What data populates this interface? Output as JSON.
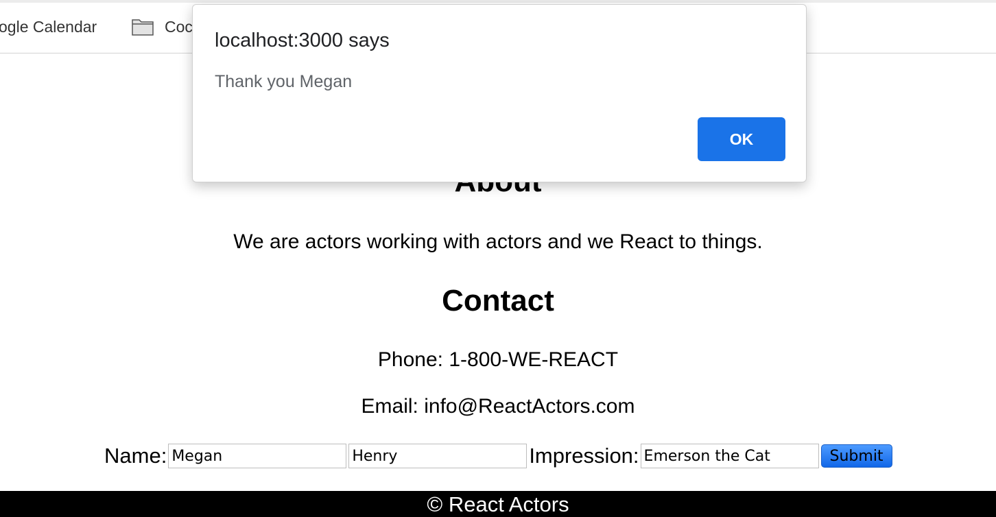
{
  "bookmarks": [
    {
      "label": "ogle Calendar"
    },
    {
      "label": "Coc",
      "icon": "folder-icon"
    }
  ],
  "page": {
    "about_heading": "About",
    "about_text": "We are actors working with actors and we React to things.",
    "contact_heading": "Contact",
    "phone": "Phone: 1-800-WE-REACT",
    "email": "Email: info@ReactActors.com"
  },
  "form": {
    "name_label": "Name:",
    "first_name_value": "Megan",
    "last_name_value": "Henry",
    "impression_label": "Impression:",
    "impression_value": "Emerson the Cat",
    "submit_label": "Submit"
  },
  "footer": {
    "text": "© React Actors"
  },
  "alert": {
    "title": "localhost:3000 says",
    "message": "Thank you Megan",
    "ok_label": "OK",
    "accent_color": "#1a73e8"
  }
}
